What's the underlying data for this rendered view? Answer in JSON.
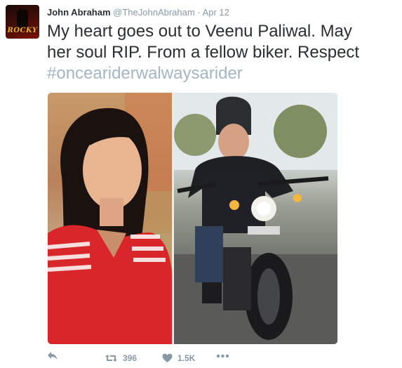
{
  "tweet": {
    "author_name": "John Abraham",
    "handle": "@TheJohnAbraham",
    "separator": "·",
    "date": "Apr 12",
    "text_line1": "My heart goes out to Veenu Paliwal. May",
    "text_line2": "her soul RIP. From a fellow biker. Respect",
    "hashtag": "#onceariderwalwaysarider"
  },
  "avatar": {
    "logo_text": "ROCKY"
  },
  "media": [
    {
      "description": "woman-portrait-photo"
    },
    {
      "description": "woman-on-motorcycle-photo"
    }
  ],
  "actions": {
    "retweet_count": "396",
    "like_count": "1.5K"
  },
  "icons": {
    "reply": "reply-icon",
    "retweet": "retweet-icon",
    "like": "heart-icon",
    "more": "more-icon"
  },
  "colors": {
    "text": "#292f33",
    "muted": "#8899a6",
    "hashtag": "#a4b5c4"
  }
}
